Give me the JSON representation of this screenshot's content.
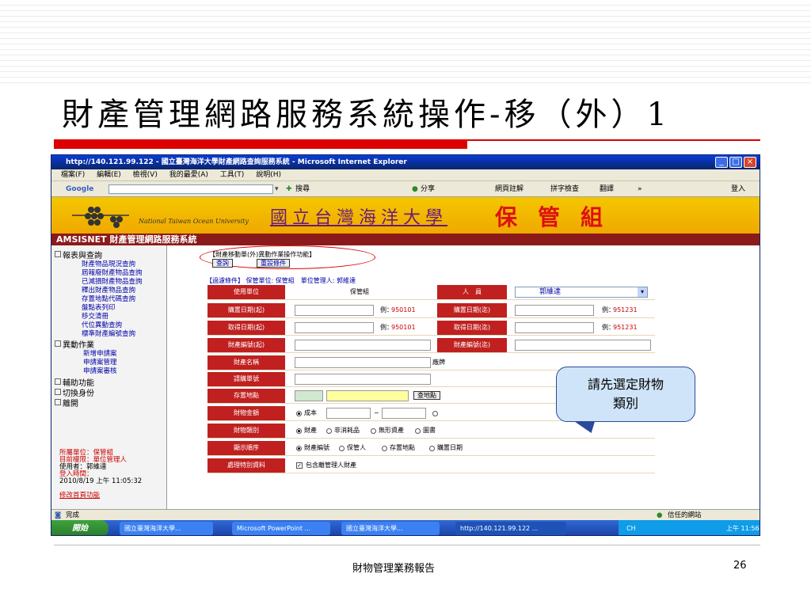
{
  "slide": {
    "title": "財產管理網路服務系統操作-移（外）1",
    "footer": "財物管理業務報告",
    "page_number": "26"
  },
  "browser": {
    "title": "http://140.121.99.122 - 國立臺灣海洋大學財產網路查詢服務系統 - Microsoft Internet Explorer",
    "menu": [
      "檔案(F)",
      "編輯(E)",
      "檢視(V)",
      "我的最愛(A)",
      "工具(T)",
      "說明(H)"
    ],
    "toolbar": {
      "google": "Google",
      "search": "搜尋",
      "share": "分享",
      "notes": "網頁註解",
      "spell": "拼字檢查",
      "translate": "翻譯",
      "more": "»",
      "signin": "登入"
    },
    "status": {
      "left": "完成",
      "zone": "信任的網站"
    }
  },
  "banner": {
    "university_en": "National Taiwan Ocean University",
    "university_zh": "國立台灣海洋大學",
    "office": "保管組"
  },
  "system_bar": "AMSISNET 財產管理網路服務系統",
  "sidebar": {
    "sections": [
      {
        "label": "報表與查詢",
        "items": [
          "財產物品現況查詢",
          "屆報廢財產物品查詢",
          "已減損財產物品查詢",
          "釋出財產物品查詢",
          "存置地點代碼查詢",
          "盤點表列印",
          "移交清冊",
          "代位異動查詢",
          "標準財產編號查詢"
        ]
      },
      {
        "label": "異動作業",
        "items": [
          "新增申請案",
          "申請案管理",
          "申請案審核"
        ]
      },
      {
        "label": "輔助功能",
        "items": []
      },
      {
        "label": "切換身份",
        "items": []
      },
      {
        "label": "離開",
        "items": []
      }
    ],
    "info": {
      "dept": "所屬單位：保管組",
      "role": "目前權限：單位管理人",
      "user": "使用者：郭維達",
      "login_label": "登入時間：",
      "login_time": "2010/8/19 上午 11:05:32",
      "link": "修改首頁功能"
    }
  },
  "form": {
    "header": "【財產移動單(外)異動作業操作功能】",
    "query_btn": "查詢",
    "reset_btn": "重設條件",
    "filter": "【過濾條件】 保管單位: 保管組　單位管理人: 郭維達",
    "use_unit_label": "使用單位",
    "use_unit_value": "保管組",
    "person_label": "人　員",
    "person_value": "郭維達",
    "buy_start_label": "購置日期(起)",
    "buy_end_label": "購置日期(迄)",
    "get_start_label": "取得日期(起)",
    "get_end_label": "取得日期(迄)",
    "example_label": "例：",
    "example_start": "950101",
    "example_end": "951231",
    "code_start_label": "財產編號(起)",
    "code_end_label": "財產編號(迄)",
    "name_label": "財產名稱",
    "name_suffix": "廠牌",
    "apply_label": "請購單號",
    "location_label": "存置地點",
    "location_btn": "查地點",
    "amount_label": "財物金額",
    "amount_opt": "成本",
    "category_label": "財物類別",
    "category_opts": [
      "財產",
      "非消耗品",
      "無形資產",
      "圖書"
    ],
    "order_label": "顯示順序",
    "order_opts": [
      "財產編號",
      "保管人",
      "存置地點",
      "購置日期"
    ],
    "special_label": "處理特別資料",
    "special_check": "包含離管理人財產"
  },
  "callout": {
    "line1": "請先選定財物",
    "line2": "類別"
  },
  "taskbar": {
    "start": "開始",
    "tasks": [
      "國立臺灣海洋大學...",
      "Microsoft PowerPoint ...",
      "國立臺灣海洋大學...",
      "http://140.121.99.122 ..."
    ],
    "lang": "CH",
    "clock": "上午 11:56"
  }
}
